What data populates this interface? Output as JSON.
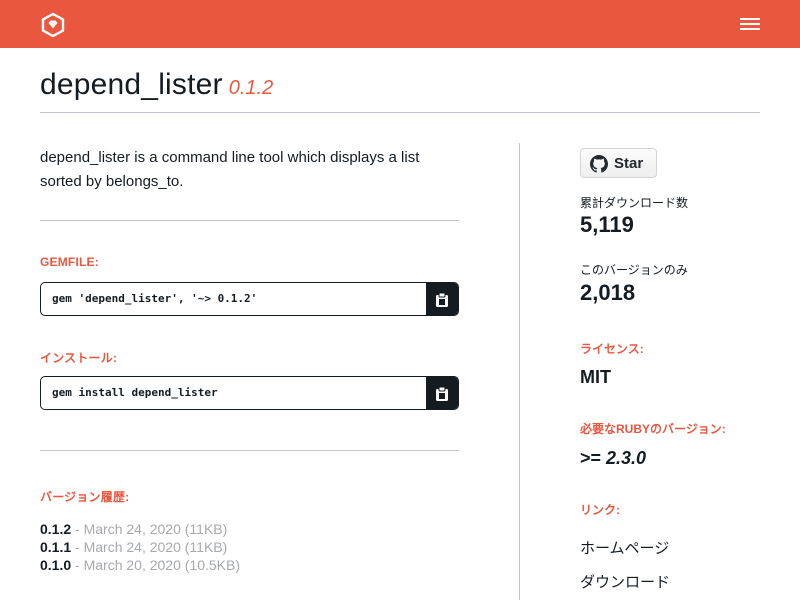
{
  "header": {
    "logo_icon": "rubygems-logo-icon",
    "menu_icon": "hamburger-menu-icon",
    "background_color": "#e9573f"
  },
  "gem": {
    "name": "depend_lister",
    "version": "0.1.2",
    "description": "depend_lister is a command line tool which displays a list sorted by belongs_to."
  },
  "gemfile": {
    "label": "GEMFILE:",
    "command": "gem 'depend_lister', '~> 0.1.2'",
    "copy_icon": "clipboard-icon"
  },
  "install": {
    "label": "インストール:",
    "command": "gem install depend_lister",
    "copy_icon": "clipboard-icon"
  },
  "versions": {
    "label": "バージョン履歴:",
    "items": [
      {
        "number": "0.1.2",
        "meta": "- March 24, 2020 (11KB)"
      },
      {
        "number": "0.1.1",
        "meta": "- March 24, 2020 (11KB)"
      },
      {
        "number": "0.1.0",
        "meta": "- March 20, 2020 (10.5KB)"
      }
    ]
  },
  "sidebar": {
    "star_button": {
      "label": "Star",
      "icon": "github-icon"
    },
    "total_downloads_label": "累計ダウンロード数",
    "total_downloads": "5,119",
    "version_downloads_label": "このバージョンのみ",
    "version_downloads": "2,018",
    "license_label": "ライセンス:",
    "license": "MIT",
    "ruby_version_label": "必要なRUBYのバージョン:",
    "ruby_version_prefix": ">= ",
    "ruby_version": "2.3.0",
    "links_label": "リンク:",
    "links": [
      {
        "label": "ホームページ"
      },
      {
        "label": "ダウンロード"
      }
    ]
  },
  "colors": {
    "accent": "#e9573f",
    "text": "#141c22",
    "muted": "#a7a9ac"
  }
}
